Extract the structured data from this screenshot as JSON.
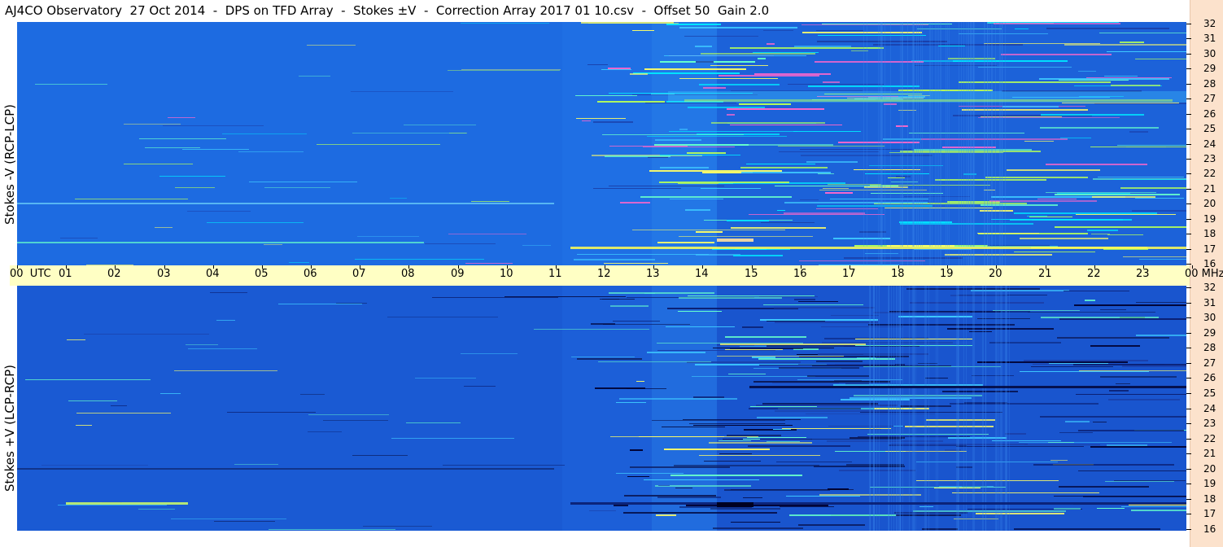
{
  "window": {
    "title": "AJ4CO Observatory  27 Oct 2014  -  DPS on TFD Array  -  Stokes ±V  -  Correction Array 2017 01 10.csv  -  Offset 50  Gain 2.0"
  },
  "panels": [
    {
      "id": "top",
      "ylabel": "Stokes -V (RCP-LCP)"
    },
    {
      "id": "bottom",
      "ylabel": "Stokes +V (LCP-RCP)"
    }
  ],
  "frequency_axis": {
    "unit": "MHz",
    "labels": [
      "32",
      "31",
      "30",
      "29",
      "28",
      "27",
      "26",
      "25",
      "24",
      "23",
      "22",
      "21",
      "20",
      "19",
      "18",
      "17",
      "16"
    ]
  },
  "time_axis": {
    "labels": [
      "00  UTC",
      "01",
      "02",
      "03",
      "04",
      "05",
      "06",
      "07",
      "08",
      "09",
      "10",
      "11",
      "12",
      "13",
      "14",
      "15",
      "16",
      "17",
      "18",
      "19",
      "20",
      "21",
      "22",
      "23",
      "00 MHz"
    ]
  },
  "colors": {
    "background": "#1f6fe4",
    "time_bar": "#ffffc4",
    "freq_axis": "#fce2cc"
  }
}
